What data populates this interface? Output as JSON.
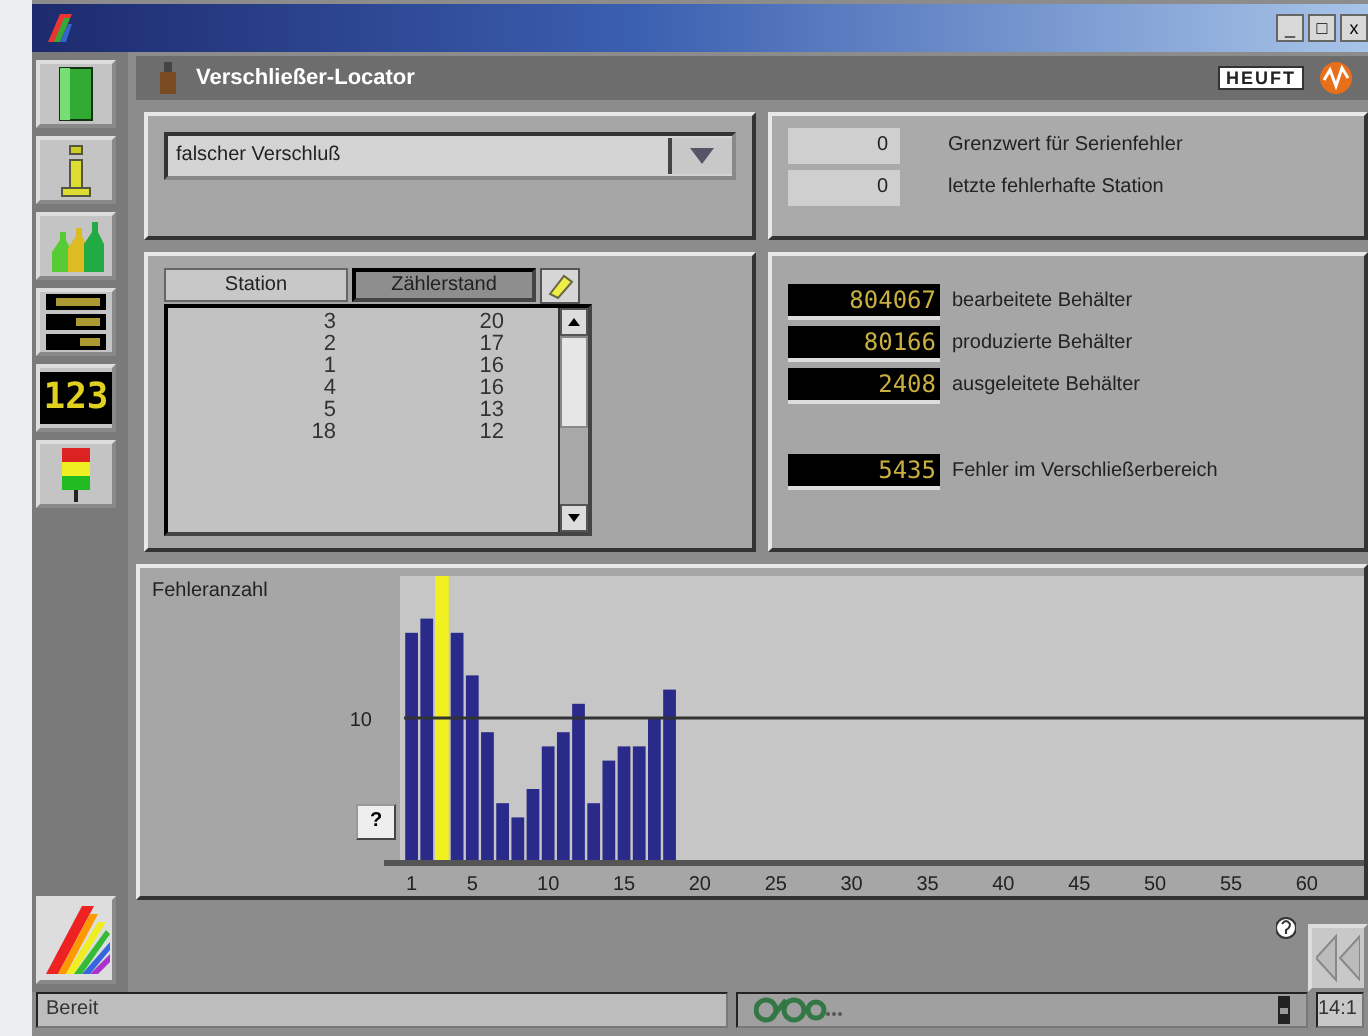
{
  "window": {
    "controls": [
      "_",
      "□",
      "x"
    ]
  },
  "toolbar": [
    {
      "kind": "door"
    },
    {
      "kind": "info"
    },
    {
      "kind": "bottles"
    },
    {
      "kind": "displays"
    },
    {
      "kind": "counter",
      "label": "123"
    },
    {
      "kind": "lamp"
    }
  ],
  "header": {
    "title": "Verschließer-Locator",
    "logo": "HEUFT"
  },
  "fault_select": {
    "value": "falscher Verschluß"
  },
  "limits": [
    {
      "value": "0",
      "label": "Grenzwert für Serienfehler"
    },
    {
      "value": "0",
      "label": "letzte fehlerhafte Station"
    }
  ],
  "table": {
    "tabs": [
      {
        "label": "Station",
        "selected": false
      },
      {
        "label": "Zählerstand",
        "selected": true
      }
    ],
    "rows": [
      [
        "3",
        "20"
      ],
      [
        "2",
        "17"
      ],
      [
        "1",
        "16"
      ],
      [
        "4",
        "16"
      ],
      [
        "5",
        "13"
      ],
      [
        "18",
        "12"
      ]
    ]
  },
  "counters": [
    {
      "value": "804067",
      "label": "bearbeitete Behälter"
    },
    {
      "value": "80166",
      "label": "produzierte Behälter"
    },
    {
      "value": "2408",
      "label": "ausgeleitete Behälter"
    },
    {
      "value": "5435",
      "label": "Fehler im Verschließerbereich",
      "gap": true
    }
  ],
  "chart": {
    "help": "?",
    "chart_data": {
      "type": "bar",
      "x": [
        1,
        2,
        3,
        4,
        5,
        6,
        7,
        8,
        9,
        10,
        11,
        12,
        13,
        14,
        15,
        16,
        17,
        18
      ],
      "series": [
        {
          "name": "Fehleranzahl",
          "color": "#2a2a8a",
          "values": [
            16,
            17,
            null,
            16,
            13,
            9,
            4,
            3,
            5,
            8,
            9,
            11,
            4,
            7,
            8,
            8,
            10,
            12
          ]
        }
      ],
      "bands": [
        {
          "axis": "x",
          "from": 2.55,
          "to": 3.45,
          "color": "#f0f020"
        }
      ],
      "xlim": [
        0.5,
        63.5
      ],
      "ylim": [
        0,
        20
      ],
      "yticks": [
        10
      ],
      "xticks": [
        1,
        5,
        10,
        15,
        20,
        25,
        30,
        35,
        40,
        45,
        50,
        55,
        60
      ]
    }
  },
  "status_bar": {
    "text": "Bereit",
    "time": "14:1"
  }
}
